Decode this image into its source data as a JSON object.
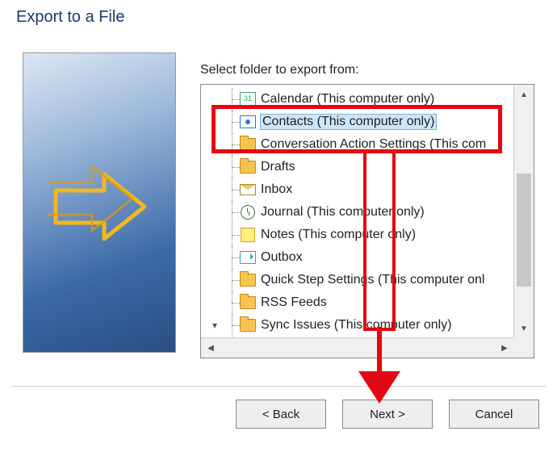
{
  "title": "Export to a File",
  "label": "Select folder to export from:",
  "tree": {
    "items": [
      {
        "icon": "calendar",
        "label": "Calendar (This computer only)",
        "selected": false
      },
      {
        "icon": "contacts",
        "label": "Contacts (This computer only)",
        "selected": true
      },
      {
        "icon": "folder",
        "label": "Conversation Action Settings (This com",
        "selected": false
      },
      {
        "icon": "folder",
        "label": "Drafts",
        "selected": false
      },
      {
        "icon": "inbox",
        "label": "Inbox",
        "selected": false
      },
      {
        "icon": "journal",
        "label": "Journal (This computer only)",
        "selected": false
      },
      {
        "icon": "notes",
        "label": "Notes (This computer only)",
        "selected": false
      },
      {
        "icon": "outbox",
        "label": "Outbox",
        "selected": false
      },
      {
        "icon": "folder",
        "label": "Quick Step Settings (This computer onl",
        "selected": false
      },
      {
        "icon": "folder",
        "label": "RSS Feeds",
        "selected": false
      },
      {
        "icon": "folder",
        "label": "Sync Issues (This computer only)",
        "selected": false,
        "expander": "v"
      }
    ]
  },
  "buttons": {
    "back": "< Back",
    "next": "Next >",
    "cancel": "Cancel"
  },
  "annotation": {
    "highlights": [
      "Contacts (This computer only)",
      "Next >"
    ]
  },
  "colors": {
    "accent": "#1a3a6e",
    "annotation": "#e30613"
  }
}
